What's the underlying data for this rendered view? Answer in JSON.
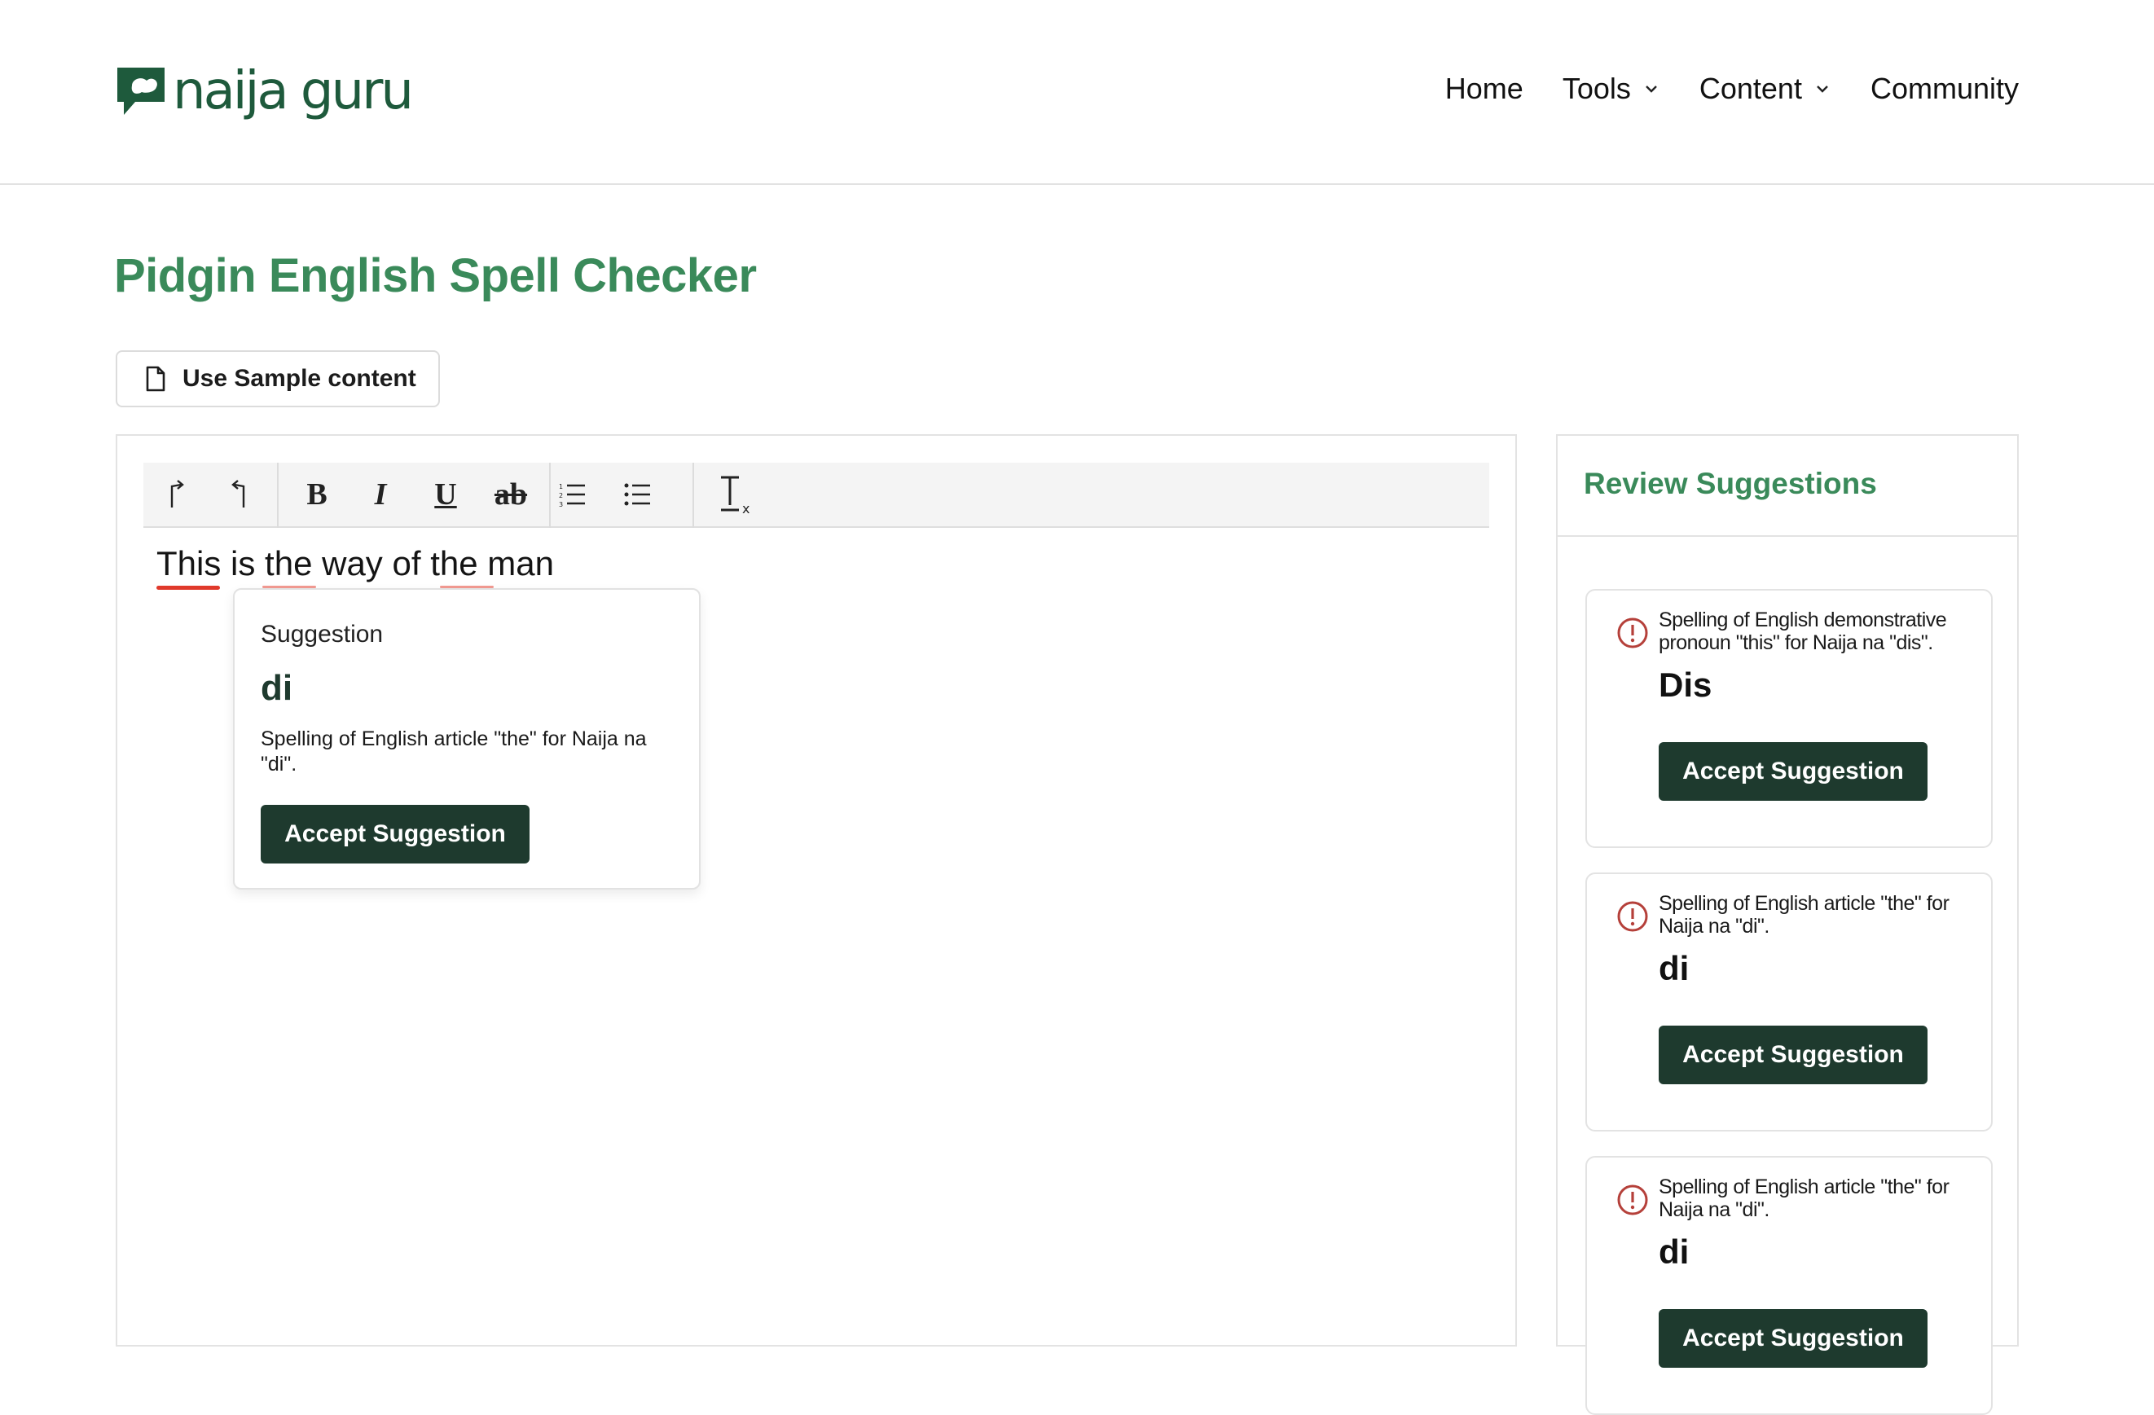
{
  "header": {
    "logo_text": "naija guru",
    "nav": [
      {
        "label": "Home"
      },
      {
        "label": "Tools"
      },
      {
        "label": "Content"
      },
      {
        "label": "Community"
      }
    ]
  },
  "page": {
    "title": "Pidgin English Spell Checker",
    "sample_button_label": "Use Sample content"
  },
  "editor": {
    "words": [
      "This",
      "is",
      "the",
      "way",
      "of",
      "the",
      "man"
    ],
    "flagged_word_colors": {
      "strong": "#e0392b",
      "soft": "#f29a92"
    }
  },
  "popover": {
    "heading": "Suggestion",
    "word": "di",
    "description": "Spelling of English article \"the\" for Naija na \"di\".",
    "accept_label": "Accept Suggestion"
  },
  "sidebar": {
    "title": "Review Suggestions",
    "cards": [
      {
        "description": "Spelling of English demonstrative pronoun \"this\" for Naija na \"dis\".",
        "word": "Dis",
        "accept_label": "Accept Suggestion",
        "icon": "alert-circle-icon"
      },
      {
        "description": "Spelling of English article \"the\" for Naija na \"di\".",
        "word": "di",
        "accept_label": "Accept Suggestion",
        "icon": "alert-circle-icon"
      },
      {
        "description": "Spelling of English article \"the\" for Naija na \"di\".",
        "word": "di",
        "accept_label": "Accept Suggestion",
        "icon": "alert-circle-icon"
      }
    ]
  },
  "colors": {
    "brand_green": "#3a8a5a",
    "dark_green_button": "#1e3a2e",
    "alert_red": "#b5403a"
  }
}
